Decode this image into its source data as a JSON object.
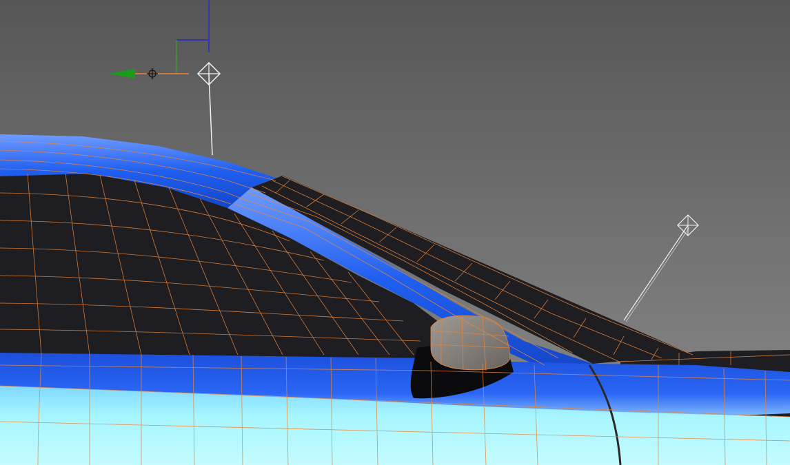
{
  "viewport": {
    "background_top": "#565656",
    "background_bottom": "#8c8c8c"
  },
  "scene": {
    "body_paint": "#1f5ff0",
    "body_highlight": "#5a8cff",
    "glass": "#1d1d22",
    "lower_panel": "#a8f6ff",
    "wireframe": "#e8863a",
    "mirror_shell": "#8a8480",
    "mirror_shadow": "#0b0b0d"
  },
  "gizmo": {
    "x_axis_color": "#1a9c1a",
    "y_axis_color": "#2828c8",
    "z_axis_color": "#3a9a3a",
    "handle_color": "#f2f2f2",
    "icons": [
      "move-gizmo-icon",
      "target-handle-icon",
      "light-target-icon"
    ]
  }
}
